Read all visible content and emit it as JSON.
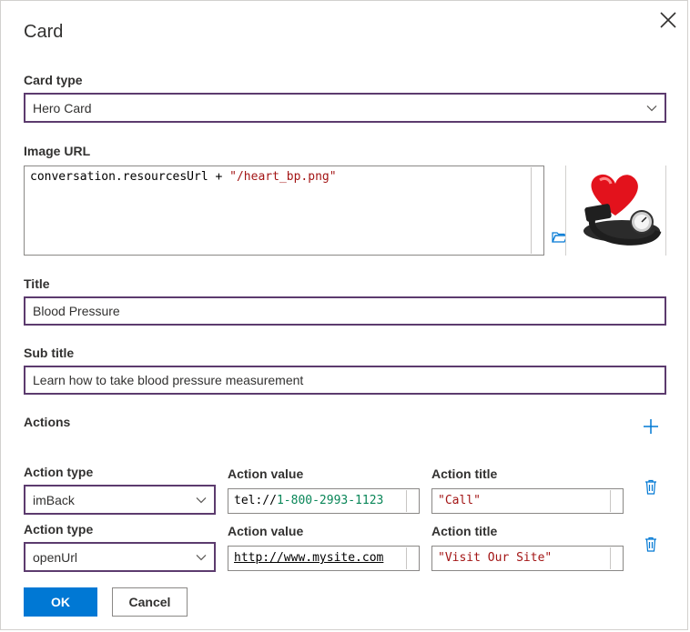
{
  "dialog": {
    "title": "Card",
    "close_icon": "close-icon"
  },
  "card_type": {
    "label": "Card type",
    "value": "Hero Card"
  },
  "image_url": {
    "label": "Image URL",
    "code_prefix": "conversation.resourcesUrl + ",
    "code_string": "\"/heart_bp.png\"",
    "browse_icon": "folder-open-icon",
    "preview_icon": "heart-blood-pressure-image"
  },
  "title_field": {
    "label": "Title",
    "value": "Blood Pressure"
  },
  "subtitle_field": {
    "label": "Sub title",
    "value": "Learn how to take blood pressure measurement"
  },
  "actions": {
    "label": "Actions",
    "add_icon": "plus-icon",
    "rows": [
      {
        "type_label": "Action type",
        "type_value": "imBack",
        "value_label": "Action value",
        "value_prefix": "tel://",
        "value_number": "1-800-2993-1123",
        "title_label": "Action title",
        "title_value": "\"Call\"",
        "delete_icon": "trash-icon"
      },
      {
        "type_label": "Action type",
        "type_value": "openUrl",
        "value_label": "Action value",
        "value_text": "http://www.mysite.com",
        "title_label": "Action title",
        "title_value": "\"Visit Our Site\"",
        "delete_icon": "trash-icon"
      }
    ]
  },
  "footer": {
    "ok_label": "OK",
    "cancel_label": "Cancel"
  },
  "colors": {
    "accent": "#0078d4",
    "border_active": "#5c3b6e",
    "string": "#a31515",
    "number": "#098658"
  }
}
